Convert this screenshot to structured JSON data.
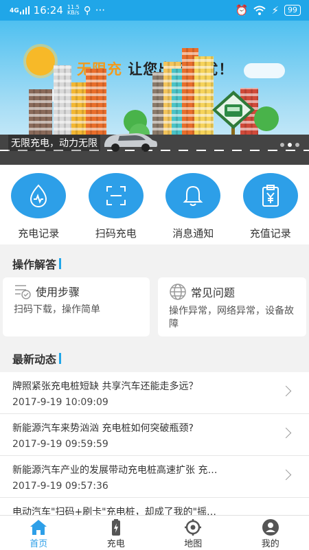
{
  "status_bar": {
    "signal": "4G",
    "time": "16:24",
    "net_speed": "11.5",
    "net_unit": "KB/s",
    "battery": "99"
  },
  "banner": {
    "brand": "无限充",
    "slogan": "让您出行无忧！",
    "caption": "无限充电，动力无限"
  },
  "menu": [
    {
      "label": "充电记录",
      "icon": "heart-pulse-drop-icon"
    },
    {
      "label": "扫码充电",
      "icon": "scan-icon"
    },
    {
      "label": "消息通知",
      "icon": "bell-icon"
    },
    {
      "label": "充值记录",
      "icon": "yen-clipboard-icon"
    }
  ],
  "faq": {
    "title": "操作解答",
    "cards": [
      {
        "title": "使用步骤",
        "desc": "扫码下载，操作简单",
        "icon": "list-check-icon"
      },
      {
        "title": "常见问题",
        "desc": "操作异常，网络异常，设备故障",
        "icon": "globe-icon"
      }
    ]
  },
  "news": {
    "title": "最新动态",
    "items": [
      {
        "title": "牌照紧张充电桩短缺 共享汽车还能走多远？",
        "date": "2017-9-19 10:09:09"
      },
      {
        "title": "新能源汽车来势汹汹 充电桩如何突破瓶颈?",
        "date": "2017-9-19 09:59:59"
      },
      {
        "title": "新能源汽车产业的发展带动充电桩高速扩张 充…",
        "date": "2017-9-19 09:57:36"
      },
      {
        "title": "电动汽车\"扫码+刷卡\"充电桩，却成了我的\"摇…",
        "date": ""
      }
    ]
  },
  "tabs": [
    {
      "label": "首页",
      "icon": "home-icon",
      "active": true
    },
    {
      "label": "充电",
      "icon": "battery-charge-icon",
      "active": false
    },
    {
      "label": "地图",
      "icon": "location-icon",
      "active": false
    },
    {
      "label": "我的",
      "icon": "user-icon",
      "active": false
    }
  ],
  "colors": {
    "accent": "#2d9fe8",
    "status_bar": "#20a6e8",
    "brand_orange": "#f29a1c"
  }
}
